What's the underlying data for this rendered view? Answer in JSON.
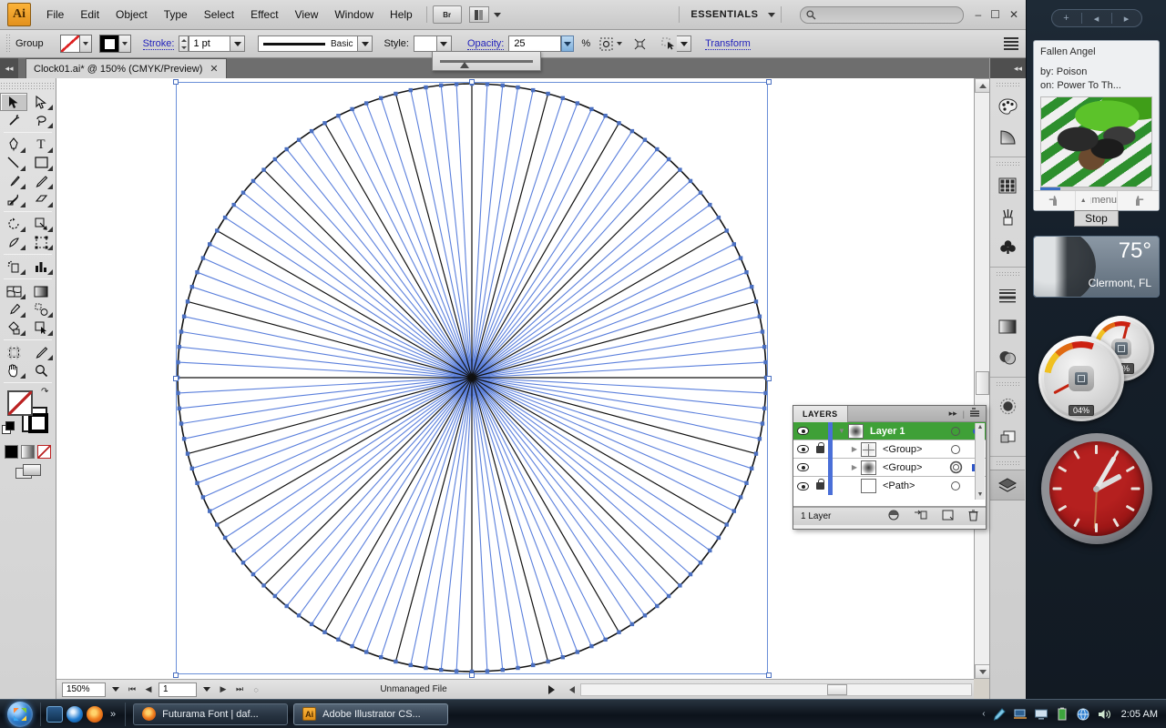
{
  "app": {
    "name": "Adobe Illustrator CS",
    "logo_text": "Ai",
    "menus": [
      "File",
      "Edit",
      "Object",
      "Type",
      "Select",
      "Effect",
      "View",
      "Window",
      "Help"
    ],
    "bridge_button": "Br",
    "workspace": "ESSENTIALS",
    "search_placeholder": "",
    "window_buttons": {
      "minimize": "–",
      "restore": "❐",
      "close": "✕"
    }
  },
  "control_bar": {
    "selection_label": "Group",
    "fill_label": "fill-swatch",
    "stroke_label": "Stroke:",
    "stroke_weight": "1 pt",
    "brush_name": "Basic",
    "style_label": "Style:",
    "opacity_label": "Opacity:",
    "opacity_value": "25",
    "opacity_unit": "%",
    "transform_link": "Transform",
    "icons": [
      "align-icon",
      "distribute-icon",
      "isolate-icon"
    ]
  },
  "document": {
    "tab_title": "Clock01.ai* @ 150% (CMYK/Preview)",
    "close_glyph": "✕"
  },
  "toolbar": {
    "tools": [
      [
        "selection-tool",
        "direct-selection-tool"
      ],
      [
        "magic-wand-tool",
        "lasso-tool"
      ],
      [
        "pen-tool",
        "type-tool"
      ],
      [
        "line-segment-tool",
        "rectangle-tool"
      ],
      [
        "paintbrush-tool",
        "pencil-tool"
      ],
      [
        "blob-brush-tool",
        "eraser-tool"
      ],
      [
        "rotate-tool",
        "scale-tool"
      ],
      [
        "warp-tool",
        "free-transform-tool"
      ],
      [
        "symbol-sprayer-tool",
        "column-graph-tool"
      ],
      [
        "mesh-tool",
        "gradient-tool"
      ],
      [
        "eyedropper-tool",
        "blend-tool"
      ],
      [
        "live-paint-bucket-tool",
        "live-paint-selection-tool"
      ],
      [
        "artboard-tool",
        "slice-tool"
      ],
      [
        "hand-tool",
        "zoom-tool"
      ]
    ],
    "fill_stroke": {
      "fill": "none",
      "stroke": "black",
      "swap_icon": "swap-fill-stroke-icon",
      "default_icon": "default-fill-stroke-icon"
    },
    "color_modes": [
      "color-mode",
      "gradient-mode",
      "none-mode"
    ],
    "screen_mode": "change-screen-mode-icon"
  },
  "status_bar": {
    "zoom": "150%",
    "page": "1",
    "status_text": "Unmanaged File"
  },
  "layers_panel": {
    "title": "LAYERS",
    "collapse_glyph": "▸▸",
    "menu_glyph": "≡",
    "rows": [
      {
        "name": "Layer 1",
        "selected": true,
        "locked": false,
        "thumb": "radial",
        "targeted": false,
        "has_selection_square": true
      },
      {
        "name": "<Group>",
        "selected": false,
        "locked": true,
        "thumb": "radial-lite",
        "targeted": false,
        "has_selection_square": false
      },
      {
        "name": "<Group>",
        "selected": false,
        "locked": false,
        "thumb": "radial",
        "targeted": true,
        "has_selection_square": true
      },
      {
        "name": "<Path>",
        "selected": false,
        "locked": true,
        "thumb": "empty",
        "targeted": false,
        "has_selection_square": false
      }
    ],
    "footer_label": "1 Layer",
    "footer_buttons": [
      "make-clipping-mask-button",
      "create-new-sublayer-button",
      "create-new-layer-button",
      "delete-selection-button"
    ]
  },
  "dock_icons": [
    "color-panel-icon",
    "color-guide-icon",
    "swatches-panel-icon",
    "brushes-panel-icon",
    "symbols-panel-icon",
    "stroke-panel-icon",
    "gradient-panel-icon",
    "transparency-panel-icon",
    "appearance-panel-icon",
    "graphic-styles-panel-icon",
    "layers-panel-icon"
  ],
  "artwork": {
    "description": "radial burst of lines inside a circle",
    "accent_blue": "#3a5fe0",
    "line_black": "#101010",
    "selection_blue": "#6a8fd8"
  },
  "sidebar": {
    "add_glyph": "+",
    "prev_glyph": "◂",
    "next_glyph": "▸",
    "media_gadget": {
      "title": "Fallen Angel",
      "by_label": "by: Poison",
      "on_label": "on: Power To Th...",
      "thumbs_down": "👎",
      "menu_label": "menu",
      "thumbs_up": "👍",
      "stop_button": "Stop"
    },
    "weather_gadget": {
      "temperature": "75°",
      "location": "Clermont, FL"
    },
    "gauges": [
      {
        "name": "cpu-gauge",
        "value": "48%"
      },
      {
        "name": "memory-gauge",
        "value": "04%"
      }
    ],
    "clock_gadget": {
      "name": "analog-clock",
      "time": "2:05"
    }
  },
  "taskbar": {
    "start_label": "start-orb",
    "quick_launch": [
      "show-desktop-icon",
      "internet-explorer-icon",
      "firefox-icon"
    ],
    "overflow_glyph": "»",
    "tasks": [
      {
        "icon": "firefox-icon",
        "label": "Futurama Font | daf..."
      },
      {
        "icon": "illustrator-icon",
        "label": "Adobe Illustrator CS..."
      }
    ],
    "tray_chevron": "‹",
    "tray_icons": [
      "network-pen-icon",
      "remote-icon",
      "display-icon",
      "battery-icon",
      "network-icon",
      "volume-icon"
    ],
    "clock": "2:05 AM"
  }
}
